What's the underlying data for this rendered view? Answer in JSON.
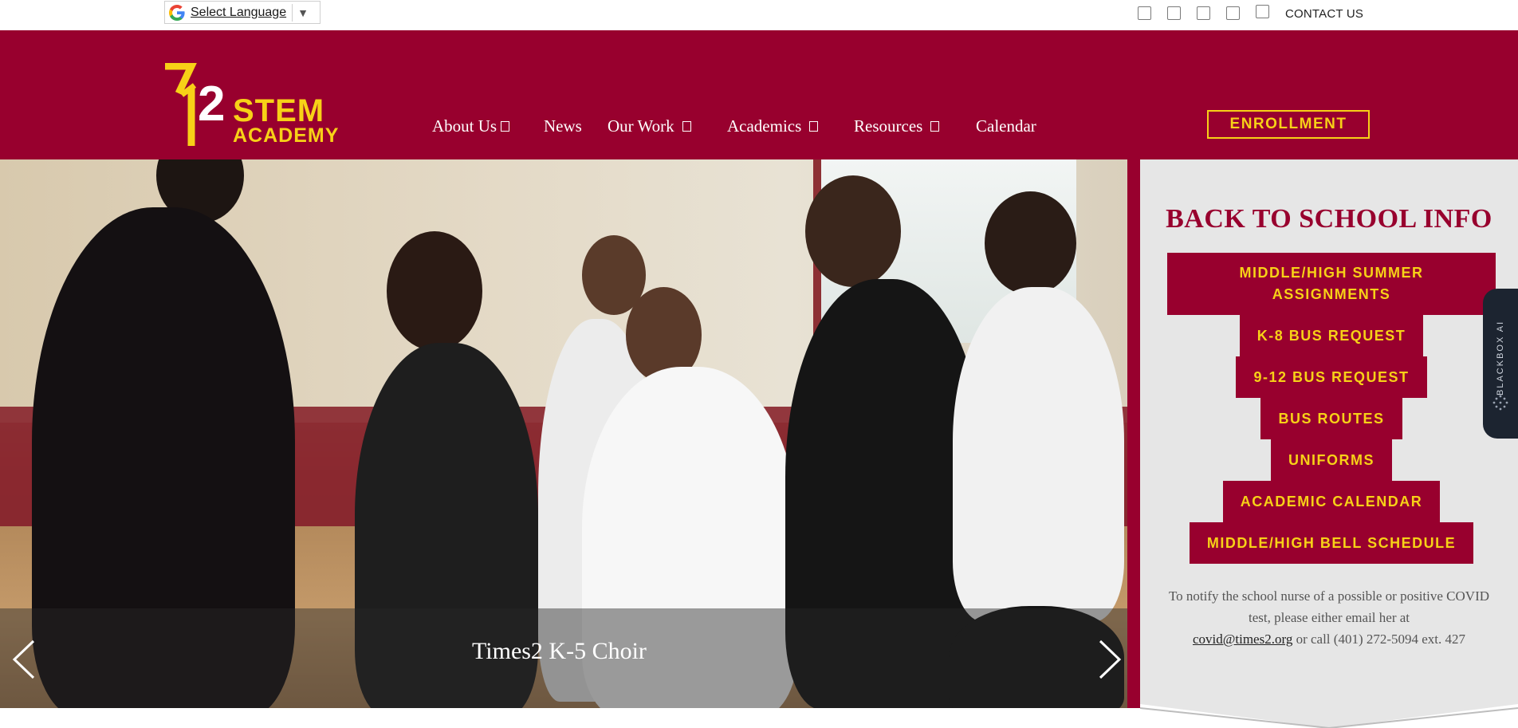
{
  "topbar": {
    "language_label": "Select Language",
    "language_caret": "▼",
    "social_icons": [
      "social-icon-1",
      "social-icon-2",
      "social-icon-3",
      "social-icon-4",
      "social-icon-5"
    ],
    "contact_label": "CONTACT US"
  },
  "brand": {
    "logo_stem": "STEM",
    "logo_academy": "ACADEMY",
    "maroon": "#98002e",
    "gold": "#f7d117"
  },
  "nav": {
    "items": [
      {
        "label": "About Us",
        "has_dropdown": true
      },
      {
        "label": "News",
        "has_dropdown": false
      },
      {
        "label": "Our Work",
        "has_dropdown": true
      },
      {
        "label": "Academics",
        "has_dropdown": true
      },
      {
        "label": "Resources",
        "has_dropdown": true
      },
      {
        "label": "Calendar",
        "has_dropdown": false
      }
    ],
    "enroll_label": "ENROLLMENT"
  },
  "hero": {
    "caption": "Times2 K-5 Choir",
    "prev_icon": "chevron-left-icon",
    "next_icon": "chevron-right-icon"
  },
  "panel": {
    "title": "BACK TO SCHOOL INFO",
    "buttons": [
      "MIDDLE/HIGH SUMMER ASSIGNMENTS",
      "K-8 BUS REQUEST",
      "9-12 BUS REQUEST",
      "BUS ROUTES",
      "UNIFORMS",
      "ACADEMIC CALENDAR",
      "MIDDLE/HIGH BELL SCHEDULE"
    ],
    "notice_text": "To notify the school nurse of a possible or positive COVID test,  please either email her at",
    "notice_email": "covid@times2.org",
    "notice_phone": " or call (401) 272-5094 ext. 427"
  },
  "side_tab": {
    "label": "BLACKBOX AI"
  }
}
